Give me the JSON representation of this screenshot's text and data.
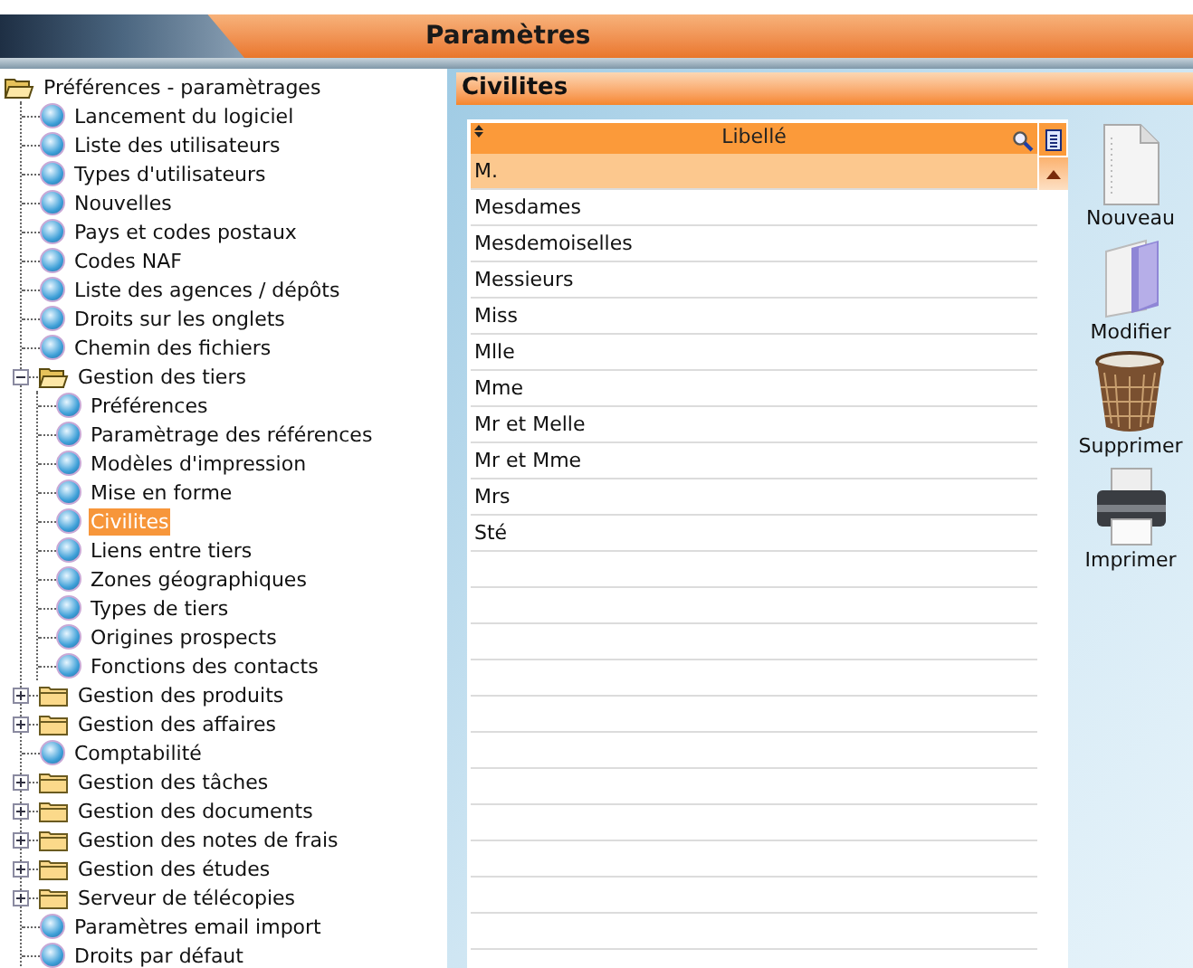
{
  "window": {
    "title": "Paramètres"
  },
  "tree": [
    {
      "label": "Préférences - paramètrages",
      "kind": "folder",
      "expanded": true,
      "selected": false,
      "children": [
        {
          "label": "Lancement du logiciel",
          "kind": "item",
          "selected": false
        },
        {
          "label": "Liste des utilisateurs",
          "kind": "item",
          "selected": false
        },
        {
          "label": "Types d'utilisateurs",
          "kind": "item",
          "selected": false
        },
        {
          "label": "Nouvelles",
          "kind": "item",
          "selected": false
        },
        {
          "label": "Pays et codes postaux",
          "kind": "item",
          "selected": false
        },
        {
          "label": "Codes NAF",
          "kind": "item",
          "selected": false
        },
        {
          "label": "Liste des agences / dépôts",
          "kind": "item",
          "selected": false
        },
        {
          "label": "Droits sur les onglets",
          "kind": "item",
          "selected": false
        },
        {
          "label": "Chemin des fichiers",
          "kind": "item",
          "selected": false
        },
        {
          "label": "Gestion des tiers",
          "kind": "folder",
          "expanded": true,
          "selected": false,
          "children": [
            {
              "label": "Préférences",
              "kind": "item",
              "selected": false
            },
            {
              "label": "Paramètrage des références",
              "kind": "item",
              "selected": false
            },
            {
              "label": "Modèles d'impression",
              "kind": "item",
              "selected": false
            },
            {
              "label": "Mise en forme",
              "kind": "item",
              "selected": false
            },
            {
              "label": "Civilites",
              "kind": "item",
              "selected": true
            },
            {
              "label": "Liens entre tiers",
              "kind": "item",
              "selected": false
            },
            {
              "label": "Zones géographiques",
              "kind": "item",
              "selected": false
            },
            {
              "label": "Types de tiers",
              "kind": "item",
              "selected": false
            },
            {
              "label": "Origines prospects",
              "kind": "item",
              "selected": false
            },
            {
              "label": "Fonctions des contacts",
              "kind": "item",
              "selected": false
            }
          ]
        },
        {
          "label": "Gestion des produits",
          "kind": "folder",
          "expanded": false,
          "selected": false
        },
        {
          "label": "Gestion des affaires",
          "kind": "folder",
          "expanded": false,
          "selected": false
        },
        {
          "label": "Comptabilité",
          "kind": "item",
          "selected": false
        },
        {
          "label": "Gestion des tâches",
          "kind": "folder",
          "expanded": false,
          "selected": false
        },
        {
          "label": "Gestion des documents",
          "kind": "folder",
          "expanded": false,
          "selected": false
        },
        {
          "label": "Gestion des notes de frais",
          "kind": "folder",
          "expanded": false,
          "selected": false
        },
        {
          "label": "Gestion des études",
          "kind": "folder",
          "expanded": false,
          "selected": false
        },
        {
          "label": "Serveur de télécopies",
          "kind": "folder",
          "expanded": false,
          "selected": false
        },
        {
          "label": "Paramètres email import",
          "kind": "item",
          "selected": false
        },
        {
          "label": "Droits par défaut",
          "kind": "item",
          "selected": false
        }
      ]
    }
  ],
  "panel": {
    "title": "Civilites"
  },
  "table": {
    "columns": [
      "Libellé"
    ],
    "rows": [
      {
        "cells": [
          "M."
        ],
        "selected": true
      },
      {
        "cells": [
          "Mesdames"
        ],
        "selected": false
      },
      {
        "cells": [
          "Mesdemoiselles"
        ],
        "selected": false
      },
      {
        "cells": [
          "Messieurs"
        ],
        "selected": false
      },
      {
        "cells": [
          "Miss"
        ],
        "selected": false
      },
      {
        "cells": [
          "Mlle"
        ],
        "selected": false
      },
      {
        "cells": [
          "Mme"
        ],
        "selected": false
      },
      {
        "cells": [
          "Mr et Melle"
        ],
        "selected": false
      },
      {
        "cells": [
          "Mr et Mme"
        ],
        "selected": false
      },
      {
        "cells": [
          "Mrs"
        ],
        "selected": false
      },
      {
        "cells": [
          "Sté"
        ],
        "selected": false
      }
    ]
  },
  "actions": [
    {
      "label": "Nouveau",
      "kind": "new"
    },
    {
      "label": "Modifier",
      "kind": "edit"
    },
    {
      "label": "Supprimer",
      "kind": "delete"
    },
    {
      "label": "Imprimer",
      "kind": "print"
    }
  ]
}
